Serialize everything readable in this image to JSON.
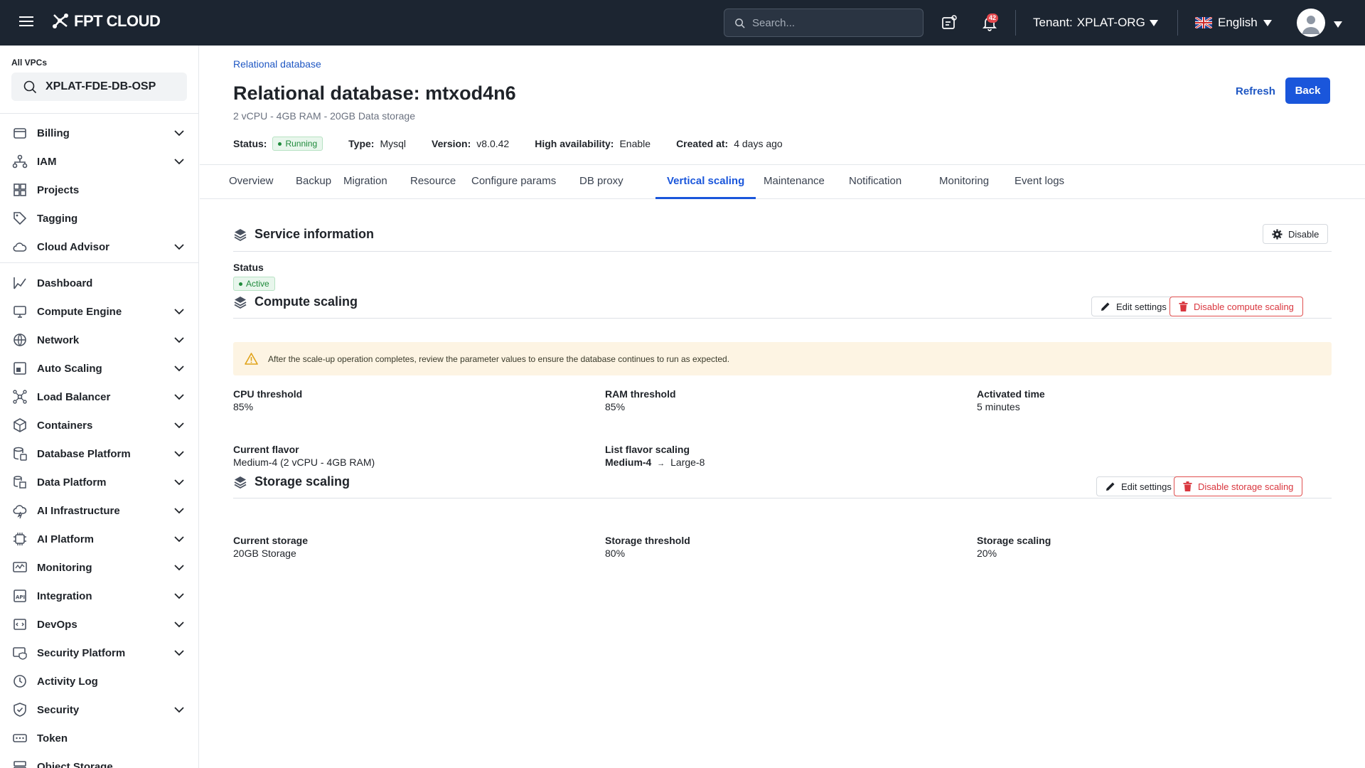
{
  "topbar": {
    "brand": "FPT CLOUD",
    "search_placeholder": "Search...",
    "notification_count": "42",
    "tenant_label": "Tenant:",
    "tenant_value": "XPLAT-ORG",
    "language": "English"
  },
  "sidebar": {
    "vpc_label": "All VPCs",
    "vpc_selected": "XPLAT-FDE-DB-OSP",
    "items": [
      {
        "label": "Billing",
        "icon": "billing-icon",
        "chevron": true
      },
      {
        "label": "IAM",
        "icon": "iam-icon",
        "chevron": true
      },
      {
        "label": "Projects",
        "icon": "projects-icon",
        "chevron": false
      },
      {
        "label": "Tagging",
        "icon": "tag-icon",
        "chevron": false
      },
      {
        "label": "Cloud Advisor",
        "icon": "cloud-advisor-icon",
        "chevron": true
      },
      {
        "label": "Dashboard",
        "icon": "dashboard-icon",
        "chevron": false
      },
      {
        "label": "Compute Engine",
        "icon": "compute-icon",
        "chevron": true
      },
      {
        "label": "Network",
        "icon": "network-icon",
        "chevron": true
      },
      {
        "label": "Auto Scaling",
        "icon": "auto-scaling-icon",
        "chevron": true
      },
      {
        "label": "Load Balancer",
        "icon": "load-balancer-icon",
        "chevron": true
      },
      {
        "label": "Containers",
        "icon": "containers-icon",
        "chevron": true
      },
      {
        "label": "Database Platform",
        "icon": "database-icon",
        "chevron": true
      },
      {
        "label": "Data Platform",
        "icon": "data-platform-icon",
        "chevron": true
      },
      {
        "label": "AI Infrastructure",
        "icon": "ai-infrastructure-icon",
        "chevron": true
      },
      {
        "label": "AI Platform",
        "icon": "ai-platform-icon",
        "chevron": true
      },
      {
        "label": "Monitoring",
        "icon": "monitoring-icon",
        "chevron": true
      },
      {
        "label": "Integration",
        "icon": "integration-icon",
        "chevron": true
      },
      {
        "label": "DevOps",
        "icon": "devops-icon",
        "chevron": true
      },
      {
        "label": "Security Platform",
        "icon": "security-platform-icon",
        "chevron": true
      },
      {
        "label": "Activity Log",
        "icon": "activity-log-icon",
        "chevron": false
      },
      {
        "label": "Security",
        "icon": "security-icon",
        "chevron": true
      },
      {
        "label": "Token",
        "icon": "token-icon",
        "chevron": false
      },
      {
        "label": "Object Storage",
        "icon": "object-storage-icon",
        "chevron": false
      }
    ]
  },
  "header": {
    "breadcrumb": "Relational database",
    "title": "Relational database: mtxod4n6",
    "subtitle": "2 vCPU - 4GB RAM - 20GB Data storage",
    "status_label": "Status:",
    "status_value": "Running",
    "type_label": "Type:",
    "type_value": "Mysql",
    "version_label": "Version:",
    "version_value": "v8.0.42",
    "ha_label": "High availability:",
    "ha_value": "Enable",
    "created_label": "Created at:",
    "created_value": "4 days ago",
    "refresh_label": "Refresh",
    "back_label": "Back"
  },
  "tabs": [
    {
      "label": "Overview",
      "active": false
    },
    {
      "label": "Backup",
      "active": false
    },
    {
      "label": "Migration",
      "active": false
    },
    {
      "label": "Resource",
      "active": false
    },
    {
      "label": "Configure params",
      "active": false
    },
    {
      "label": "DB proxy",
      "active": false
    },
    {
      "label": "Vertical scaling",
      "active": true
    },
    {
      "label": "Maintenance",
      "active": false
    },
    {
      "label": "Notification",
      "active": false
    },
    {
      "label": "Monitoring",
      "active": false
    },
    {
      "label": "Event logs",
      "active": false
    }
  ],
  "service": {
    "title": "Service information",
    "disable_label": "Disable",
    "status_label": "Status",
    "status_value": "Active"
  },
  "compute": {
    "title": "Compute scaling",
    "edit_label": "Edit settings",
    "disable_label": "Disable compute scaling",
    "warning": "After the scale-up operation completes, review the parameter values to ensure the database continues to run as expected.",
    "cpu_label": "CPU threshold",
    "cpu_value": "85%",
    "ram_label": "RAM threshold",
    "ram_value": "85%",
    "activated_label": "Activated time",
    "activated_value": "5 minutes",
    "flavor_label": "Current flavor",
    "flavor_value": "Medium-4 (2 vCPU - 4GB RAM)",
    "list_label": "List flavor scaling",
    "list_from": "Medium-4",
    "list_arrow": "→",
    "list_to": "Large-8"
  },
  "storage": {
    "title": "Storage scaling",
    "edit_label": "Edit settings",
    "disable_label": "Disable storage scaling",
    "current_label": "Current storage",
    "current_value": "20GB Storage",
    "threshold_label": "Storage threshold",
    "threshold_value": "80%",
    "scaling_label": "Storage scaling",
    "scaling_value": "20%"
  },
  "colors": {
    "topbar": "#1c2531",
    "primary": "#1a56db",
    "danger": "#d9363e",
    "success": "#1f8a3b",
    "warning_bg": "#fdf4e3"
  }
}
